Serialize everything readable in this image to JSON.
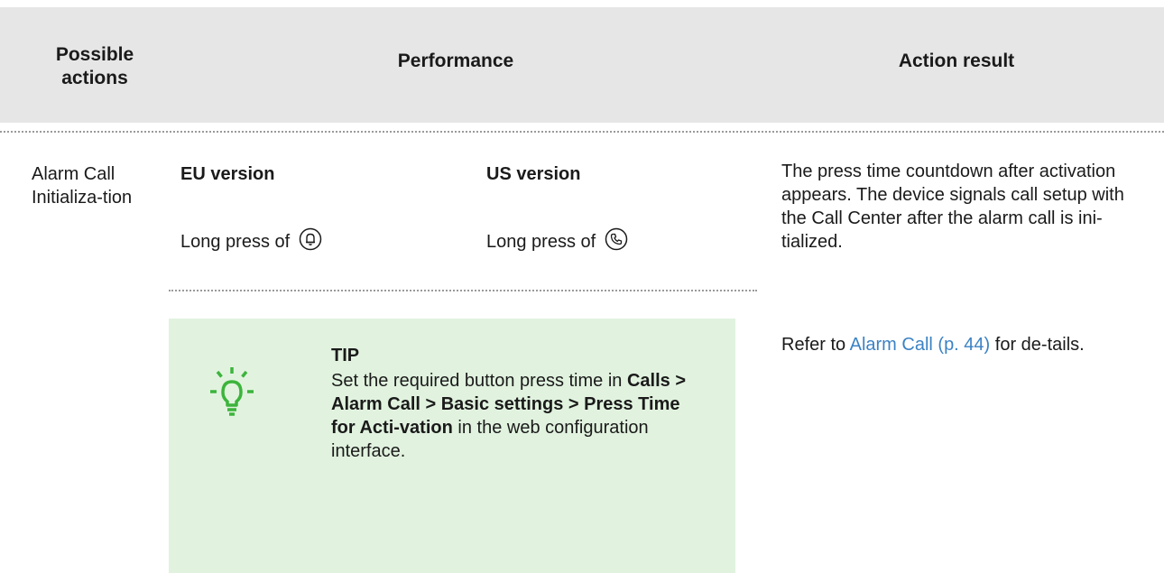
{
  "header": {
    "possible_actions": "Possible actions",
    "performance": "Performance",
    "action_result": "Action result"
  },
  "row": {
    "action_name": "Alarm Call Initializa-tion",
    "eu": {
      "title": "EU version",
      "press_text": "Long press of",
      "icon": "alarm-bell-button-icon"
    },
    "us": {
      "title": "US version",
      "press_text": "Long press of",
      "icon": "phone-button-icon"
    },
    "result": "The press time countdown after activation appears. The device signals call setup with the Call Center after the alarm call is ini-tialized.",
    "refer_prefix": "Refer to",
    "refer_link": "Alarm Call (p. 44)",
    "refer_suffix": "for de-tails."
  },
  "tip": {
    "label": "TIP",
    "icon": "lightbulb-icon",
    "text_1": "Set the required button press time in",
    "path": "Calls > Alarm Call > Basic settings > Press Time for Acti-vation",
    "text_2": "in the web configuration interface."
  },
  "colors": {
    "header_bg": "#e6e6e6",
    "tip_bg": "#e1f3df",
    "tip_icon": "#3cb43c",
    "link": "#3b82c4"
  }
}
